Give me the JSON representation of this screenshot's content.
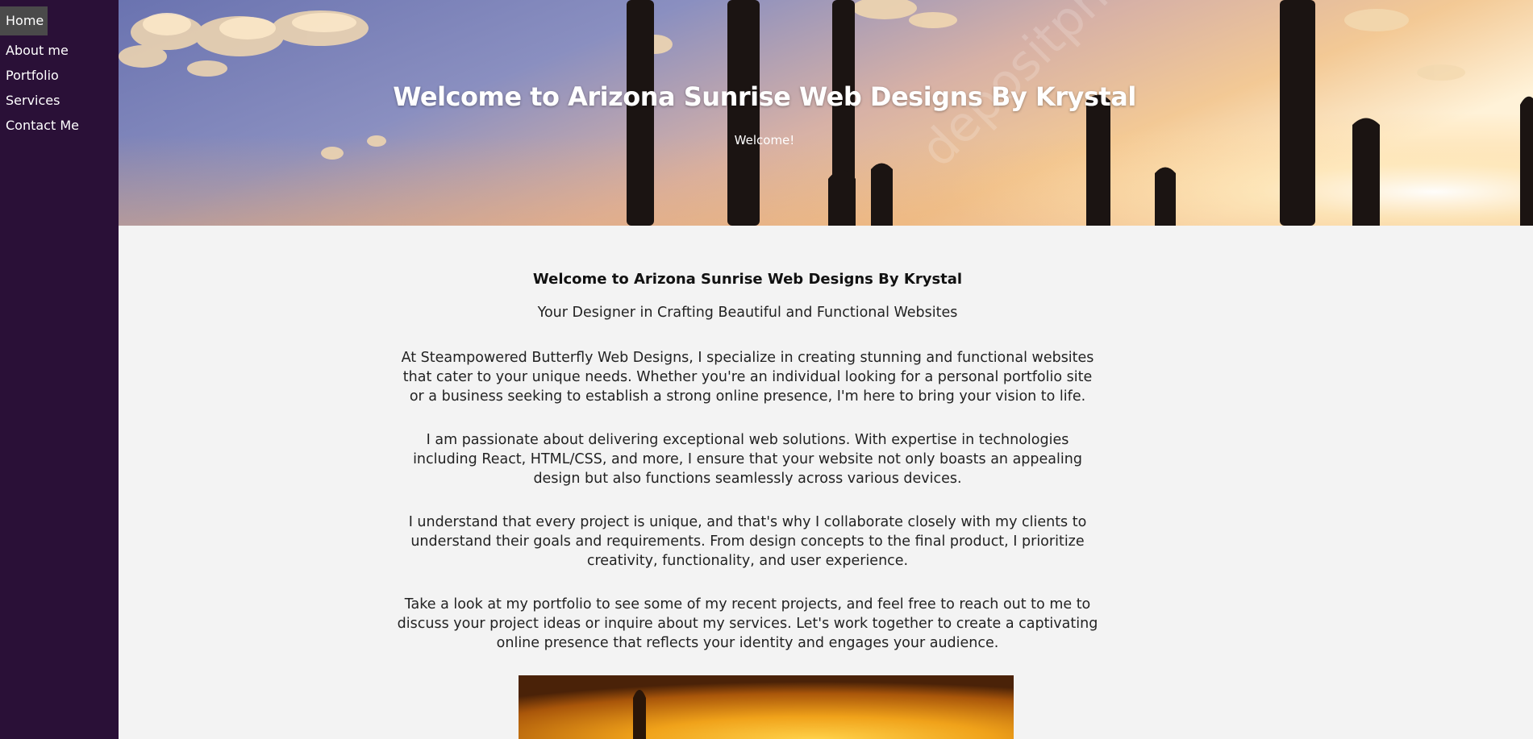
{
  "nav": {
    "items": [
      {
        "label": "Home",
        "active": true
      },
      {
        "label": "About me",
        "active": false
      },
      {
        "label": "Portfolio",
        "active": false
      },
      {
        "label": "Services",
        "active": false
      },
      {
        "label": "Contact Me",
        "active": false
      }
    ]
  },
  "hero": {
    "title": "Welcome to Arizona Sunrise Web Designs By Krystal",
    "subtitle": "Welcome!",
    "watermark": "depositphotos"
  },
  "main": {
    "heading": "Welcome to Arizona Sunrise Web Designs By Krystal",
    "tagline": "Your Designer in Crafting Beautiful and Functional Websites",
    "paragraphs": [
      "At Steampowered Butterfly Web Designs, I specialize in creating stunning and functional websites that cater to your unique needs. Whether you're an individual looking for a personal portfolio site or a business seeking to establish a strong online presence, I'm here to bring your vision to life.",
      "I am passionate about delivering exceptional web solutions. With expertise in technologies including React, HTML/CSS, and more, I ensure that your website not only boasts an appealing design but also functions seamlessly across various devices.",
      "I understand that every project is unique, and that's why I collaborate closely with my clients to understand their goals and requirements. From design concepts to the final product, I prioritize creativity, functionality, and user experience.",
      "Take a look at my portfolio to see some of my recent projects, and feel free to reach out to me to discuss your project ideas or inquire about my services. Let's work together to create a captivating online presence that reflects your identity and engages your audience."
    ]
  },
  "colors": {
    "sidebar": "#2a1037",
    "active_nav": "#4a4a4a",
    "page_bg": "#f3f3f3"
  }
}
